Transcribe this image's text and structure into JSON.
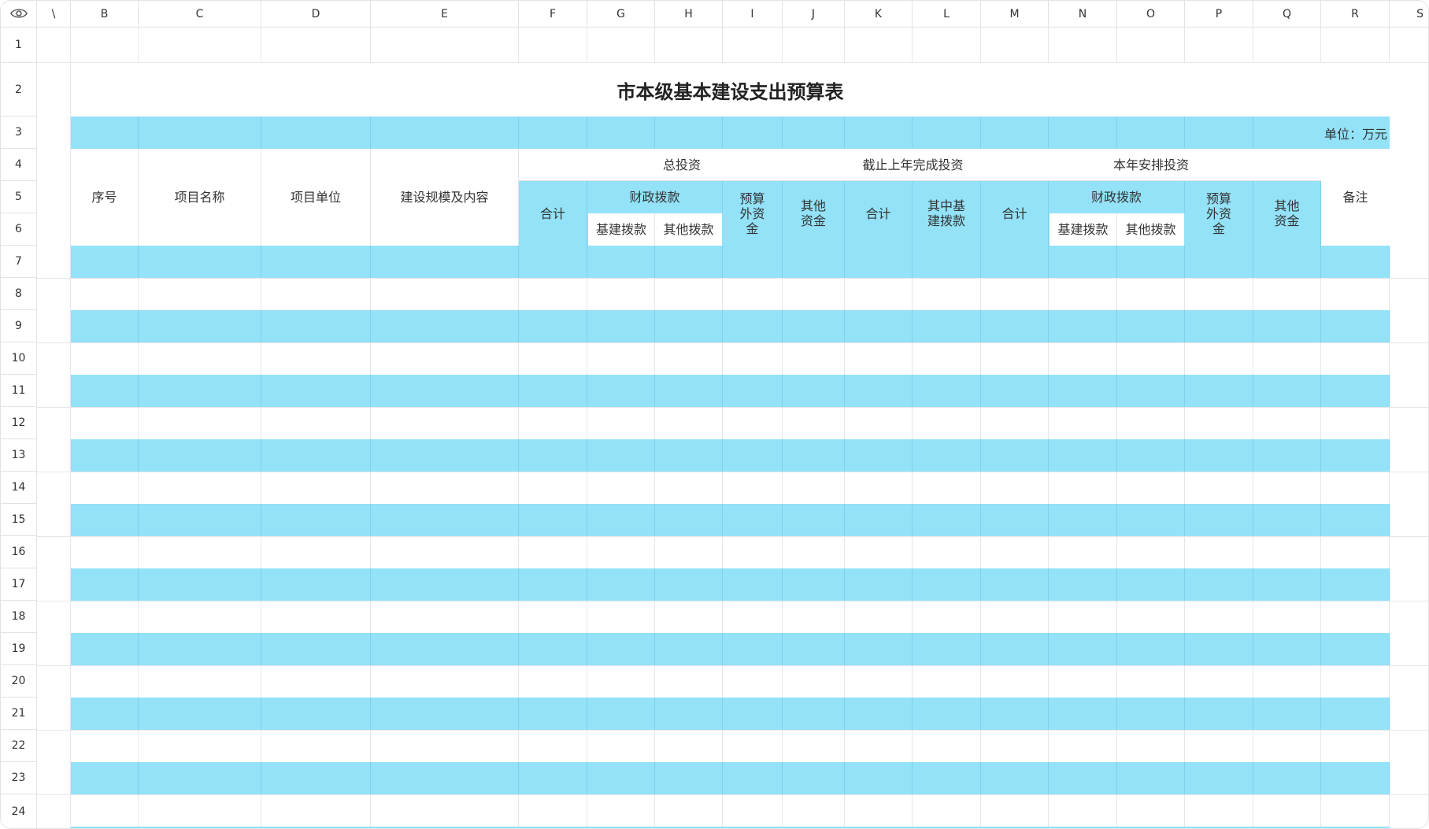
{
  "sheet": {
    "columns": [
      "\\",
      "B",
      "C",
      "D",
      "E",
      "F",
      "G",
      "H",
      "I",
      "J",
      "K",
      "L",
      "M",
      "N",
      "O",
      "P",
      "Q",
      "R",
      "S"
    ],
    "rows": [
      "1",
      "2",
      "3",
      "4",
      "5",
      "6",
      "7",
      "8",
      "9",
      "10",
      "11",
      "12",
      "13",
      "14",
      "15",
      "16",
      "17",
      "18",
      "19",
      "20",
      "21",
      "22",
      "23",
      "24"
    ],
    "title": "市本级基本建设支出预算表",
    "unit": "单位：万元",
    "headers": {
      "seq": "序号",
      "project_name": "项目名称",
      "project_unit": "项目单位",
      "scale": "建设规模及内容",
      "total_investment": "总投资",
      "completed_last_year": "截止上年完成投资",
      "this_year": "本年安排投资",
      "notes": "备注",
      "subtotal": "合计",
      "fiscal": "财政拨款",
      "infra_fund": "基建拨款",
      "other_fund": "其他拨款",
      "extra_budget": "预算外资金",
      "other_money": "其他资金",
      "of_which_infra": "其中基建拨款"
    },
    "colors": {
      "band": "#93e2f8",
      "grid": "#e4e4e4"
    }
  }
}
